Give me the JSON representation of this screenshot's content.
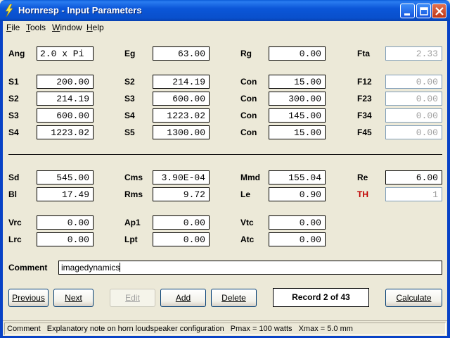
{
  "window": {
    "title": "Hornresp - Input Parameters"
  },
  "menu": [
    {
      "label": "File",
      "accel": "F",
      "rest": "ile"
    },
    {
      "label": "Tools",
      "accel": "T",
      "rest": "ools"
    },
    {
      "label": "Window",
      "accel": "W",
      "rest": "indow"
    },
    {
      "label": "Help",
      "accel": "H",
      "rest": "elp"
    }
  ],
  "params": {
    "ang": {
      "label": "Ang",
      "value": "2.0 x Pi"
    },
    "eg": {
      "label": "Eg",
      "value": "63.00"
    },
    "rg": {
      "label": "Rg",
      "value": "0.00"
    },
    "fta": {
      "label": "Fta",
      "value": "2.33"
    },
    "s1": {
      "label": "S1",
      "value": "200.00"
    },
    "s2a": {
      "label": "S2",
      "value": "214.19"
    },
    "con1": {
      "label": "Con",
      "value": "15.00"
    },
    "f12": {
      "label": "F12",
      "value": "0.00"
    },
    "s2b": {
      "label": "S2",
      "value": "214.19"
    },
    "s3a": {
      "label": "S3",
      "value": "600.00"
    },
    "con2": {
      "label": "Con",
      "value": "300.00"
    },
    "f23": {
      "label": "F23",
      "value": "0.00"
    },
    "s3b": {
      "label": "S3",
      "value": "600.00"
    },
    "s4a": {
      "label": "S4",
      "value": "1223.02"
    },
    "con3": {
      "label": "Con",
      "value": "145.00"
    },
    "f34": {
      "label": "F34",
      "value": "0.00"
    },
    "s4b": {
      "label": "S4",
      "value": "1223.02"
    },
    "s5": {
      "label": "S5",
      "value": "1300.00"
    },
    "con4": {
      "label": "Con",
      "value": "15.00"
    },
    "f45": {
      "label": "F45",
      "value": "0.00"
    },
    "sd": {
      "label": "Sd",
      "value": "545.00"
    },
    "cms": {
      "label": "Cms",
      "value": "3.90E-04"
    },
    "mmd": {
      "label": "Mmd",
      "value": "155.04"
    },
    "re": {
      "label": "Re",
      "value": "6.00"
    },
    "bl": {
      "label": "Bl",
      "value": "17.49"
    },
    "rms": {
      "label": "Rms",
      "value": "9.72"
    },
    "le": {
      "label": "Le",
      "value": "0.90"
    },
    "th": {
      "label": "TH",
      "value": "1"
    },
    "vrc": {
      "label": "Vrc",
      "value": "0.00"
    },
    "ap1": {
      "label": "Ap1",
      "value": "0.00"
    },
    "vtc": {
      "label": "Vtc",
      "value": "0.00"
    },
    "lrc": {
      "label": "Lrc",
      "value": "0.00"
    },
    "lpt": {
      "label": "Lpt",
      "value": "0.00"
    },
    "atc": {
      "label": "Atc",
      "value": "0.00"
    }
  },
  "comment": {
    "label": "Comment",
    "value": "imagedynamics"
  },
  "buttons": {
    "previous": "Previous",
    "next": "Next",
    "edit": "Edit",
    "add": "Add",
    "delete": "Delete",
    "calculate": "Calculate"
  },
  "record": "Record 2 of 43",
  "status": {
    "label": "Comment",
    "text": "Explanatory note on horn loudspeaker configuration",
    "pmax": "Pmax = 100 watts",
    "xmax": "Xmax = 5.0 mm"
  },
  "colors": {
    "titlebar": "#0b56d8",
    "background": "#ece9d8",
    "th_label": "#c00000",
    "disabled_text": "#a0a0a0"
  }
}
